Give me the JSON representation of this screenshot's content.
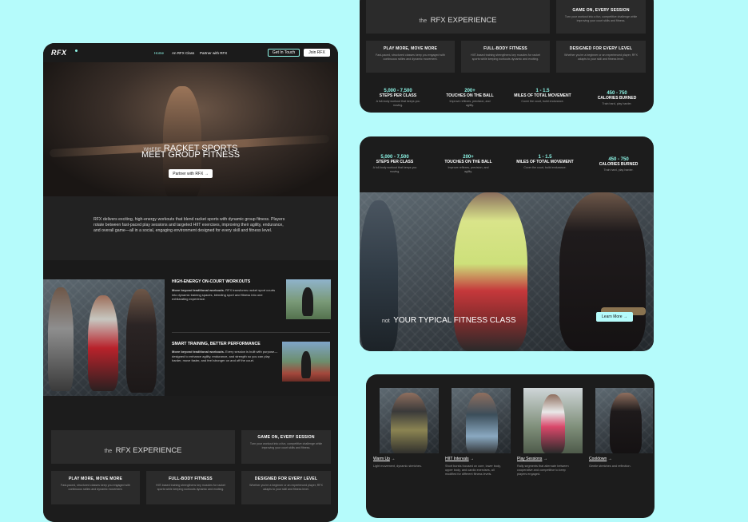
{
  "brand": {
    "logo": "RFX"
  },
  "nav": {
    "items": [
      {
        "label": "Home"
      },
      {
        "label": "An RFX Class"
      },
      {
        "label": "Partner with RFX"
      }
    ],
    "get_in_touch": "Get In Touch",
    "join": "Join RFX"
  },
  "hero": {
    "where": "WHERE",
    "line1": "RACKET SPORTS",
    "line2": "MEET GROUP FITNESS",
    "cta": "Partner with RFX",
    "cta_arrow": "→"
  },
  "intro": {
    "text": "RFX delivers exciting, high-energy workouts that blend racket sports with dynamic group fitness. Players rotate between fast-paced play sessions and targeted HIIT exercises, improving their agility, endurance, and overall game—all in a social, engaging environment designed for every skill and fitness level."
  },
  "features": [
    {
      "title": "HIGH-ENERGY ON-COURT WORKOUTS",
      "bold": "Move beyond traditional workouts.",
      "text": " RFX transforms racket sport courts into dynamic training spaces, blending sport and fitness into one exhilarating experience."
    },
    {
      "title": "SMART TRAINING, BETTER PERFORMANCE",
      "bold": "Move beyond traditional workouts.",
      "text": " Every session is built with purpose—designed to enhance agility, endurance, and strength so you can play harder, move faster, and feel stronger on and off the court."
    }
  ],
  "experience": {
    "title_prefix": "the",
    "title": "RFX EXPERIENCE",
    "tiles": [
      {
        "title": "GAME ON, EVERY SESSION",
        "desc": "Turn your workout into a fun, competitive challenge while improving your court skills and fitness."
      },
      {
        "title": "PLAY MORE, MOVE MORE",
        "desc": "Fast-paced, structured classes keep you engaged with continuous rallies and dynamic movement."
      },
      {
        "title": "FULL-BODY FITNESS",
        "desc": "HIIT-based training strengthens key muscles for racket sports while keeping workouts dynamic and exciting."
      },
      {
        "title": "DESIGNED FOR EVERY LEVEL",
        "desc": "Whether you're a beginner or an experienced player, RFX adapts to your skill and fitness level."
      }
    ]
  },
  "stats": [
    {
      "value": "5,000 - 7,500",
      "label": "STEPS PER CLASS",
      "desc": "A full-body workout that keeps you moving."
    },
    {
      "value": "200+",
      "label": "TOUCHES ON THE BALL",
      "desc": "Improve reflexes, precision, and agility."
    },
    {
      "value": "1 - 1.5",
      "label": "MILES OF TOTAL MOVEMENT",
      "desc": "Cover the court, build endurance."
    },
    {
      "value": "450 - 750",
      "label": "CALORIES BURNED",
      "desc": "Train hard, play harder."
    }
  ],
  "banner": {
    "prefix": "not",
    "title": "YOUR TYPICAL FITNESS CLASS",
    "cta": "Learn More",
    "cta_arrow": "→"
  },
  "class_flow": [
    {
      "label": "Warm Up",
      "desc": "Light movement, dynamic stretches."
    },
    {
      "label": "HIIT Intervals",
      "desc": "Short bursts focused on core, lower body, upper body, and cardio exercises, all modified for different fitness levels."
    },
    {
      "label": "Play Sessions",
      "desc": "Rally segments that alternate between cooperative and competitive to keep players engaged."
    },
    {
      "label": "Cooldown",
      "desc": "Gentle stretches and reflection."
    }
  ],
  "colors": {
    "accent": "#8df5e6",
    "bg": "#b5fbfb",
    "card": "#1f1f1f",
    "tile": "#2b2b2b"
  }
}
